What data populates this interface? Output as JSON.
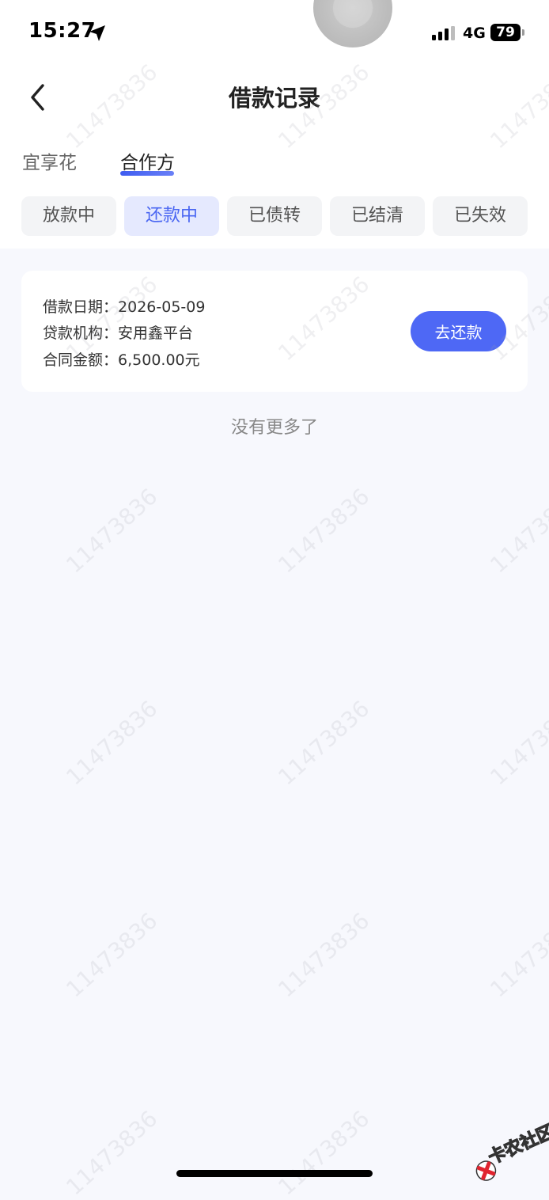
{
  "status_bar": {
    "time": "15:27",
    "network": "4G",
    "battery": "79"
  },
  "header": {
    "title": "借款记录"
  },
  "main_tabs": [
    {
      "label": "宜享花",
      "active": false
    },
    {
      "label": "合作方",
      "active": true
    }
  ],
  "filter_tabs": [
    {
      "label": "放款中",
      "active": false
    },
    {
      "label": "还款中",
      "active": true
    },
    {
      "label": "已债转",
      "active": false
    },
    {
      "label": "已结清",
      "active": false
    },
    {
      "label": "已失效",
      "active": false
    }
  ],
  "records": [
    {
      "loan_date_label": "借款日期：",
      "loan_date": "2026-05-09",
      "lender_label": "贷款机构：",
      "lender": "安用鑫平台",
      "amount_label": "合同金额：",
      "amount": "6,500.00元",
      "action_label": "去还款"
    }
  ],
  "footer_text": "没有更多了",
  "watermark_text": "11473836",
  "logo_text": "卡农社区",
  "colors": {
    "accent": "#4e68f5",
    "chip_active_bg": "#e5e9fe",
    "page_bg": "#f7f8fd"
  }
}
